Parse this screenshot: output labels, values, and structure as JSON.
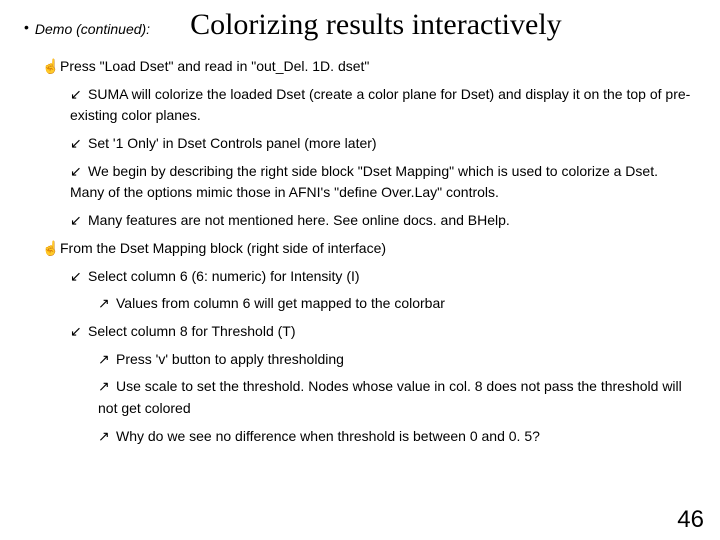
{
  "header": {
    "bullet": "•",
    "demo": "Demo (continued):",
    "title": "Colorizing results interactively"
  },
  "glyphs": {
    "hand": "☝",
    "arrow_dl": "↙",
    "arrow_ur": "↗"
  },
  "lines": {
    "a1": "Press \"Load Dset\" and read in \"out_Del. 1D. dset\"",
    "b1": "SUMA will colorize the loaded Dset (create a color plane for Dset) and display it on the top of pre-existing color planes.",
    "b2": "Set '1 Only' in Dset Controls panel (more later)",
    "b3": "We begin by describing the right side block \"Dset Mapping\" which is used to colorize a Dset. Many of the options mimic those in AFNI's \"define Over.Lay\" controls.",
    "b4": "Many features are not mentioned here. See online docs. and BHelp.",
    "a2": "From the Dset Mapping block (right side of interface)",
    "c1": "Select column 6 (6: numeric) for Intensity (I)",
    "d1": "Values from column 6 will get mapped to the colorbar",
    "c2": "Select column 8 for Threshold (T)",
    "d2": "Press 'v' button to apply thresholding",
    "d3": "Use scale to set the threshold. Nodes whose value in col. 8 does not pass the threshold will not get colored",
    "d4": "Why do we see no difference when threshold is between 0 and 0. 5?"
  },
  "page": "46"
}
